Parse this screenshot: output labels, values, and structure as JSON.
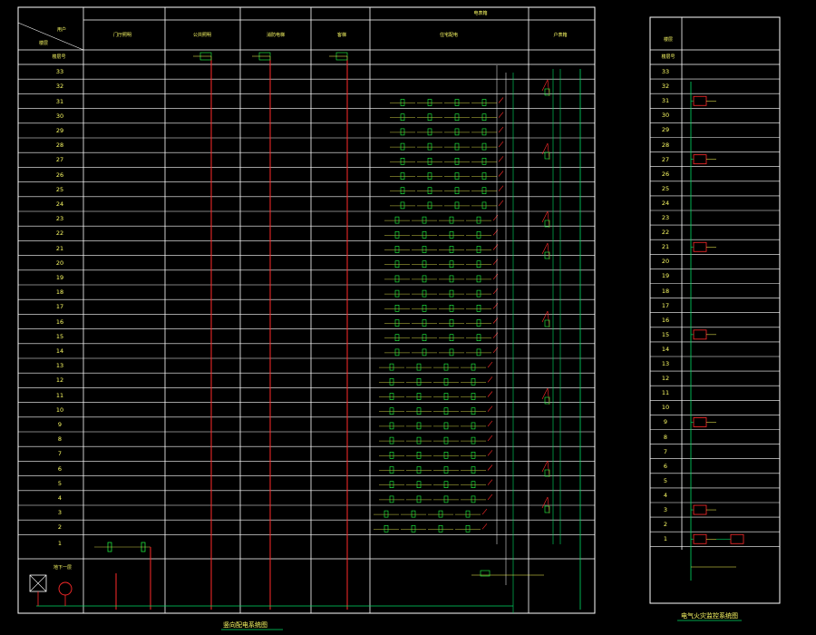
{
  "colors": {
    "background": "#000000",
    "frame": "#ffffff",
    "feeder": "#ff2a2a",
    "breaker": "#22ff44",
    "text": "#ffff55",
    "ground": "#00dd66"
  },
  "main_panel": {
    "corner_top": "用户",
    "corner_bottom": "楼层",
    "group_header": "电表箱",
    "columns": [
      "门厅照明",
      "公共照明",
      "消防电梯",
      "客梯",
      "住宅配电",
      "户表箱"
    ],
    "floor_label_header": "楼层号",
    "floors": [
      "33",
      "32",
      "31",
      "30",
      "29",
      "28",
      "27",
      "26",
      "25",
      "24",
      "23",
      "22",
      "21",
      "20",
      "19",
      "18",
      "17",
      "16",
      "15",
      "14",
      "13",
      "12",
      "11",
      "10",
      "9",
      "8",
      "7",
      "6",
      "5",
      "4",
      "3",
      "2",
      "1"
    ],
    "basement_label": "地下一层",
    "title": "竖向配电系统图"
  },
  "side_panel": {
    "header": "楼层",
    "floor_label_header": "楼层号",
    "floors": [
      "33",
      "32",
      "31",
      "30",
      "29",
      "28",
      "27",
      "26",
      "25",
      "24",
      "23",
      "22",
      "21",
      "20",
      "19",
      "18",
      "17",
      "16",
      "15",
      "14",
      "13",
      "12",
      "11",
      "10",
      "9",
      "8",
      "7",
      "6",
      "5",
      "4",
      "3",
      "2",
      "1"
    ],
    "device_floors": [
      "31",
      "27",
      "21",
      "15",
      "9",
      "3",
      "1"
    ],
    "title": "电气火灾监控系统图"
  }
}
